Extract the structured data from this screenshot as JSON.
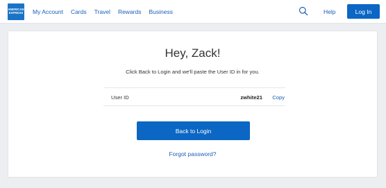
{
  "brand": {
    "logo_line1": "AMERICAN",
    "logo_line2": "EXPRESS",
    "accent_color": "#0b66c4",
    "link_color": "#1a5eb8"
  },
  "nav": {
    "items": [
      {
        "label": "My Account"
      },
      {
        "label": "Cards"
      },
      {
        "label": "Travel"
      },
      {
        "label": "Rewards"
      },
      {
        "label": "Business"
      }
    ],
    "search_icon": "search-icon",
    "help_label": "Help",
    "login_label": "Log In"
  },
  "main": {
    "greeting": "Hey, Zack!",
    "instruction": "Click Back to Login and we'll paste the User ID in for you.",
    "userid_label": "User ID",
    "userid_value": "zwhite21",
    "copy_label": "Copy",
    "back_button_label": "Back to Login",
    "forgot_password_label": "Forgot password?"
  }
}
